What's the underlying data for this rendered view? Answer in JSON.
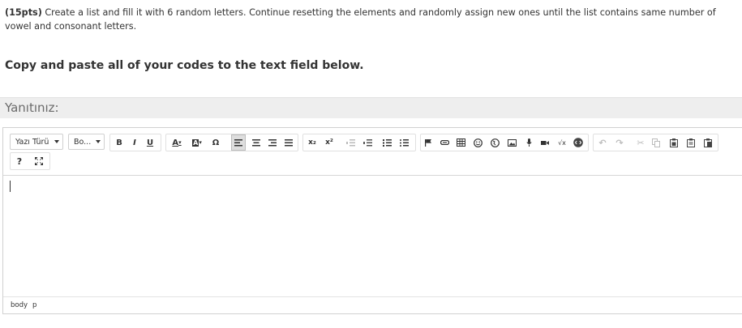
{
  "question": {
    "points": "(15pts)",
    "text": " Create a list and fill it with 6 random letters. Continue resetting the elements and randomly assign new ones until the list contains same number of vowel and consonant letters."
  },
  "instruction": "Copy and paste all of your codes to the text field below.",
  "answer_label": "Yanıtınız:",
  "toolbar": {
    "font_family": "Yazı Türü",
    "font_size": "Bo...",
    "bold": "B",
    "italic": "I",
    "underline": "U",
    "text_color": "A",
    "bg_color": "A",
    "special_char": "Ω",
    "subscript": "x₂",
    "superscript": "x²",
    "help": "?",
    "icons": [
      "align-left-icon",
      "align-center-icon",
      "align-right-icon",
      "align-justify-icon",
      "outdent-icon",
      "indent-icon",
      "numbered-list-icon",
      "bullet-list-icon",
      "flag-icon",
      "link-icon",
      "table-icon",
      "emoji-icon",
      "globe-icon",
      "image-icon",
      "microphone-icon",
      "video-icon",
      "sqrt-icon",
      "code-icon",
      "undo-icon",
      "redo-icon",
      "cut-icon",
      "copy-icon",
      "paste-icon",
      "paste-text-icon",
      "paste-word-icon",
      "fullscreen-icon"
    ]
  },
  "path": {
    "body": "body",
    "p": "p"
  },
  "colors": {
    "answer_bar": "#eeeeee",
    "border": "#d1d1d1",
    "selected": "#dedede"
  }
}
